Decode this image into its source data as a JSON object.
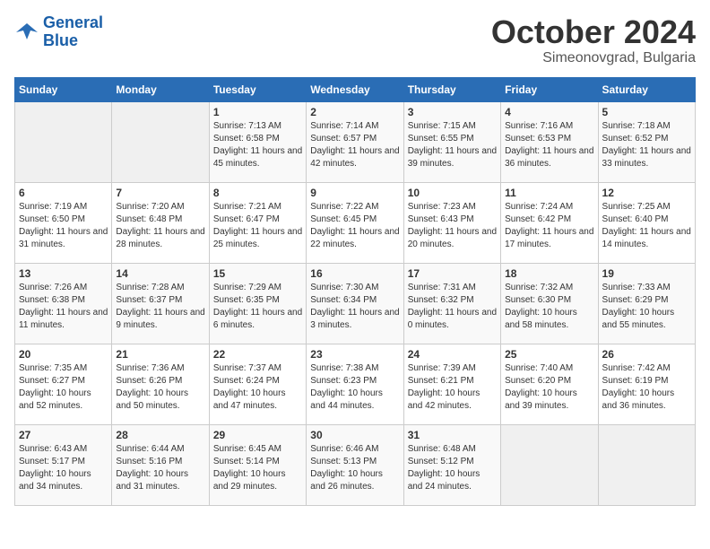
{
  "logo": {
    "line1": "General",
    "line2": "Blue"
  },
  "title": "October 2024",
  "subtitle": "Simeonovgrad, Bulgaria",
  "days_header": [
    "Sunday",
    "Monday",
    "Tuesday",
    "Wednesday",
    "Thursday",
    "Friday",
    "Saturday"
  ],
  "weeks": [
    [
      {
        "day": "",
        "info": ""
      },
      {
        "day": "",
        "info": ""
      },
      {
        "day": "1",
        "info": "Sunrise: 7:13 AM\nSunset: 6:58 PM\nDaylight: 11 hours and 45 minutes."
      },
      {
        "day": "2",
        "info": "Sunrise: 7:14 AM\nSunset: 6:57 PM\nDaylight: 11 hours and 42 minutes."
      },
      {
        "day": "3",
        "info": "Sunrise: 7:15 AM\nSunset: 6:55 PM\nDaylight: 11 hours and 39 minutes."
      },
      {
        "day": "4",
        "info": "Sunrise: 7:16 AM\nSunset: 6:53 PM\nDaylight: 11 hours and 36 minutes."
      },
      {
        "day": "5",
        "info": "Sunrise: 7:18 AM\nSunset: 6:52 PM\nDaylight: 11 hours and 33 minutes."
      }
    ],
    [
      {
        "day": "6",
        "info": "Sunrise: 7:19 AM\nSunset: 6:50 PM\nDaylight: 11 hours and 31 minutes."
      },
      {
        "day": "7",
        "info": "Sunrise: 7:20 AM\nSunset: 6:48 PM\nDaylight: 11 hours and 28 minutes."
      },
      {
        "day": "8",
        "info": "Sunrise: 7:21 AM\nSunset: 6:47 PM\nDaylight: 11 hours and 25 minutes."
      },
      {
        "day": "9",
        "info": "Sunrise: 7:22 AM\nSunset: 6:45 PM\nDaylight: 11 hours and 22 minutes."
      },
      {
        "day": "10",
        "info": "Sunrise: 7:23 AM\nSunset: 6:43 PM\nDaylight: 11 hours and 20 minutes."
      },
      {
        "day": "11",
        "info": "Sunrise: 7:24 AM\nSunset: 6:42 PM\nDaylight: 11 hours and 17 minutes."
      },
      {
        "day": "12",
        "info": "Sunrise: 7:25 AM\nSunset: 6:40 PM\nDaylight: 11 hours and 14 minutes."
      }
    ],
    [
      {
        "day": "13",
        "info": "Sunrise: 7:26 AM\nSunset: 6:38 PM\nDaylight: 11 hours and 11 minutes."
      },
      {
        "day": "14",
        "info": "Sunrise: 7:28 AM\nSunset: 6:37 PM\nDaylight: 11 hours and 9 minutes."
      },
      {
        "day": "15",
        "info": "Sunrise: 7:29 AM\nSunset: 6:35 PM\nDaylight: 11 hours and 6 minutes."
      },
      {
        "day": "16",
        "info": "Sunrise: 7:30 AM\nSunset: 6:34 PM\nDaylight: 11 hours and 3 minutes."
      },
      {
        "day": "17",
        "info": "Sunrise: 7:31 AM\nSunset: 6:32 PM\nDaylight: 11 hours and 0 minutes."
      },
      {
        "day": "18",
        "info": "Sunrise: 7:32 AM\nSunset: 6:30 PM\nDaylight: 10 hours and 58 minutes."
      },
      {
        "day": "19",
        "info": "Sunrise: 7:33 AM\nSunset: 6:29 PM\nDaylight: 10 hours and 55 minutes."
      }
    ],
    [
      {
        "day": "20",
        "info": "Sunrise: 7:35 AM\nSunset: 6:27 PM\nDaylight: 10 hours and 52 minutes."
      },
      {
        "day": "21",
        "info": "Sunrise: 7:36 AM\nSunset: 6:26 PM\nDaylight: 10 hours and 50 minutes."
      },
      {
        "day": "22",
        "info": "Sunrise: 7:37 AM\nSunset: 6:24 PM\nDaylight: 10 hours and 47 minutes."
      },
      {
        "day": "23",
        "info": "Sunrise: 7:38 AM\nSunset: 6:23 PM\nDaylight: 10 hours and 44 minutes."
      },
      {
        "day": "24",
        "info": "Sunrise: 7:39 AM\nSunset: 6:21 PM\nDaylight: 10 hours and 42 minutes."
      },
      {
        "day": "25",
        "info": "Sunrise: 7:40 AM\nSunset: 6:20 PM\nDaylight: 10 hours and 39 minutes."
      },
      {
        "day": "26",
        "info": "Sunrise: 7:42 AM\nSunset: 6:19 PM\nDaylight: 10 hours and 36 minutes."
      }
    ],
    [
      {
        "day": "27",
        "info": "Sunrise: 6:43 AM\nSunset: 5:17 PM\nDaylight: 10 hours and 34 minutes."
      },
      {
        "day": "28",
        "info": "Sunrise: 6:44 AM\nSunset: 5:16 PM\nDaylight: 10 hours and 31 minutes."
      },
      {
        "day": "29",
        "info": "Sunrise: 6:45 AM\nSunset: 5:14 PM\nDaylight: 10 hours and 29 minutes."
      },
      {
        "day": "30",
        "info": "Sunrise: 6:46 AM\nSunset: 5:13 PM\nDaylight: 10 hours and 26 minutes."
      },
      {
        "day": "31",
        "info": "Sunrise: 6:48 AM\nSunset: 5:12 PM\nDaylight: 10 hours and 24 minutes."
      },
      {
        "day": "",
        "info": ""
      },
      {
        "day": "",
        "info": ""
      }
    ]
  ]
}
